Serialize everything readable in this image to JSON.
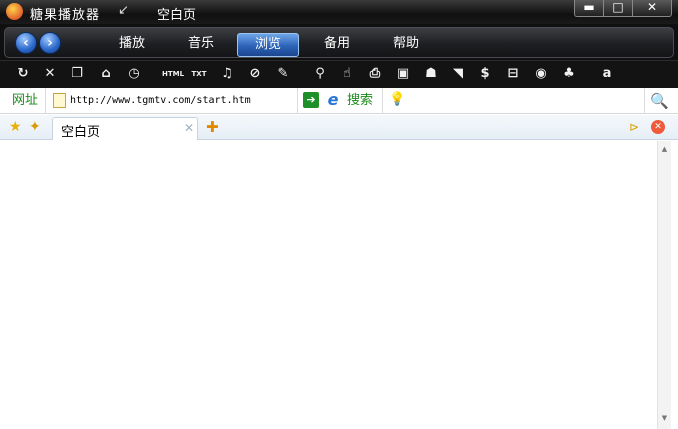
{
  "titlebar": {
    "app_title": "糖果播放器",
    "mini_icon": "↙",
    "page_name": "空白页",
    "minimize": "▬",
    "maximize": "□",
    "close": "✕"
  },
  "nav": {
    "back_icon": "back-arrow-icon",
    "forward_icon": "forward-arrow-icon",
    "tabs": [
      {
        "label": "播放"
      },
      {
        "label": "音乐"
      },
      {
        "label": "浏览",
        "active": true
      },
      {
        "label": "备用"
      },
      {
        "label": "帮助"
      }
    ]
  },
  "toolbar": {
    "items": [
      {
        "name": "refresh-icon",
        "glyph": "↻"
      },
      {
        "name": "stop-icon",
        "glyph": "✕"
      },
      {
        "name": "copy-icon",
        "glyph": "❐"
      },
      {
        "name": "home-icon",
        "glyph": "⌂"
      },
      {
        "name": "history-icon",
        "glyph": "◷"
      },
      {
        "name": "html-icon",
        "glyph": "HTML"
      },
      {
        "name": "text-icon",
        "glyph": "TXT"
      },
      {
        "name": "music-icon",
        "glyph": "♫"
      },
      {
        "name": "compass-icon",
        "glyph": "⊘"
      },
      {
        "name": "tools-icon",
        "glyph": "✎"
      },
      {
        "name": "zoom-icon",
        "glyph": "⚲"
      },
      {
        "name": "hand-icon",
        "glyph": "☝"
      },
      {
        "name": "page-find-icon",
        "glyph": "⎙"
      },
      {
        "name": "image-icon",
        "glyph": "▣"
      },
      {
        "name": "users-icon",
        "glyph": "☗"
      },
      {
        "name": "rss-icon",
        "glyph": "◥"
      },
      {
        "name": "dollar-icon",
        "glyph": "$"
      },
      {
        "name": "cart-icon",
        "glyph": "⊟"
      },
      {
        "name": "soccer-icon",
        "glyph": "◉"
      },
      {
        "name": "club-icon",
        "glyph": "♣"
      },
      {
        "name": "amazon-icon",
        "glyph": "a"
      }
    ]
  },
  "address": {
    "label": "网址",
    "url": "http://www.tgmtv.com/start.htm",
    "go_glyph": "➔",
    "ie_glyph": "e",
    "search_label": "搜索",
    "bulb_glyph": "💡",
    "magnifier_glyph": "🔍",
    "search_value": ""
  },
  "tabs": {
    "star_glyph": "★",
    "fav_add_glyph": "✦",
    "active_tab_label": "空白页",
    "tab_close_glyph": "✕",
    "new_tab_glyph": "✚",
    "more_glyph": "⊳",
    "close_all_glyph": "✕"
  },
  "scrollbar": {
    "up_glyph": "▲",
    "down_glyph": "▼"
  }
}
